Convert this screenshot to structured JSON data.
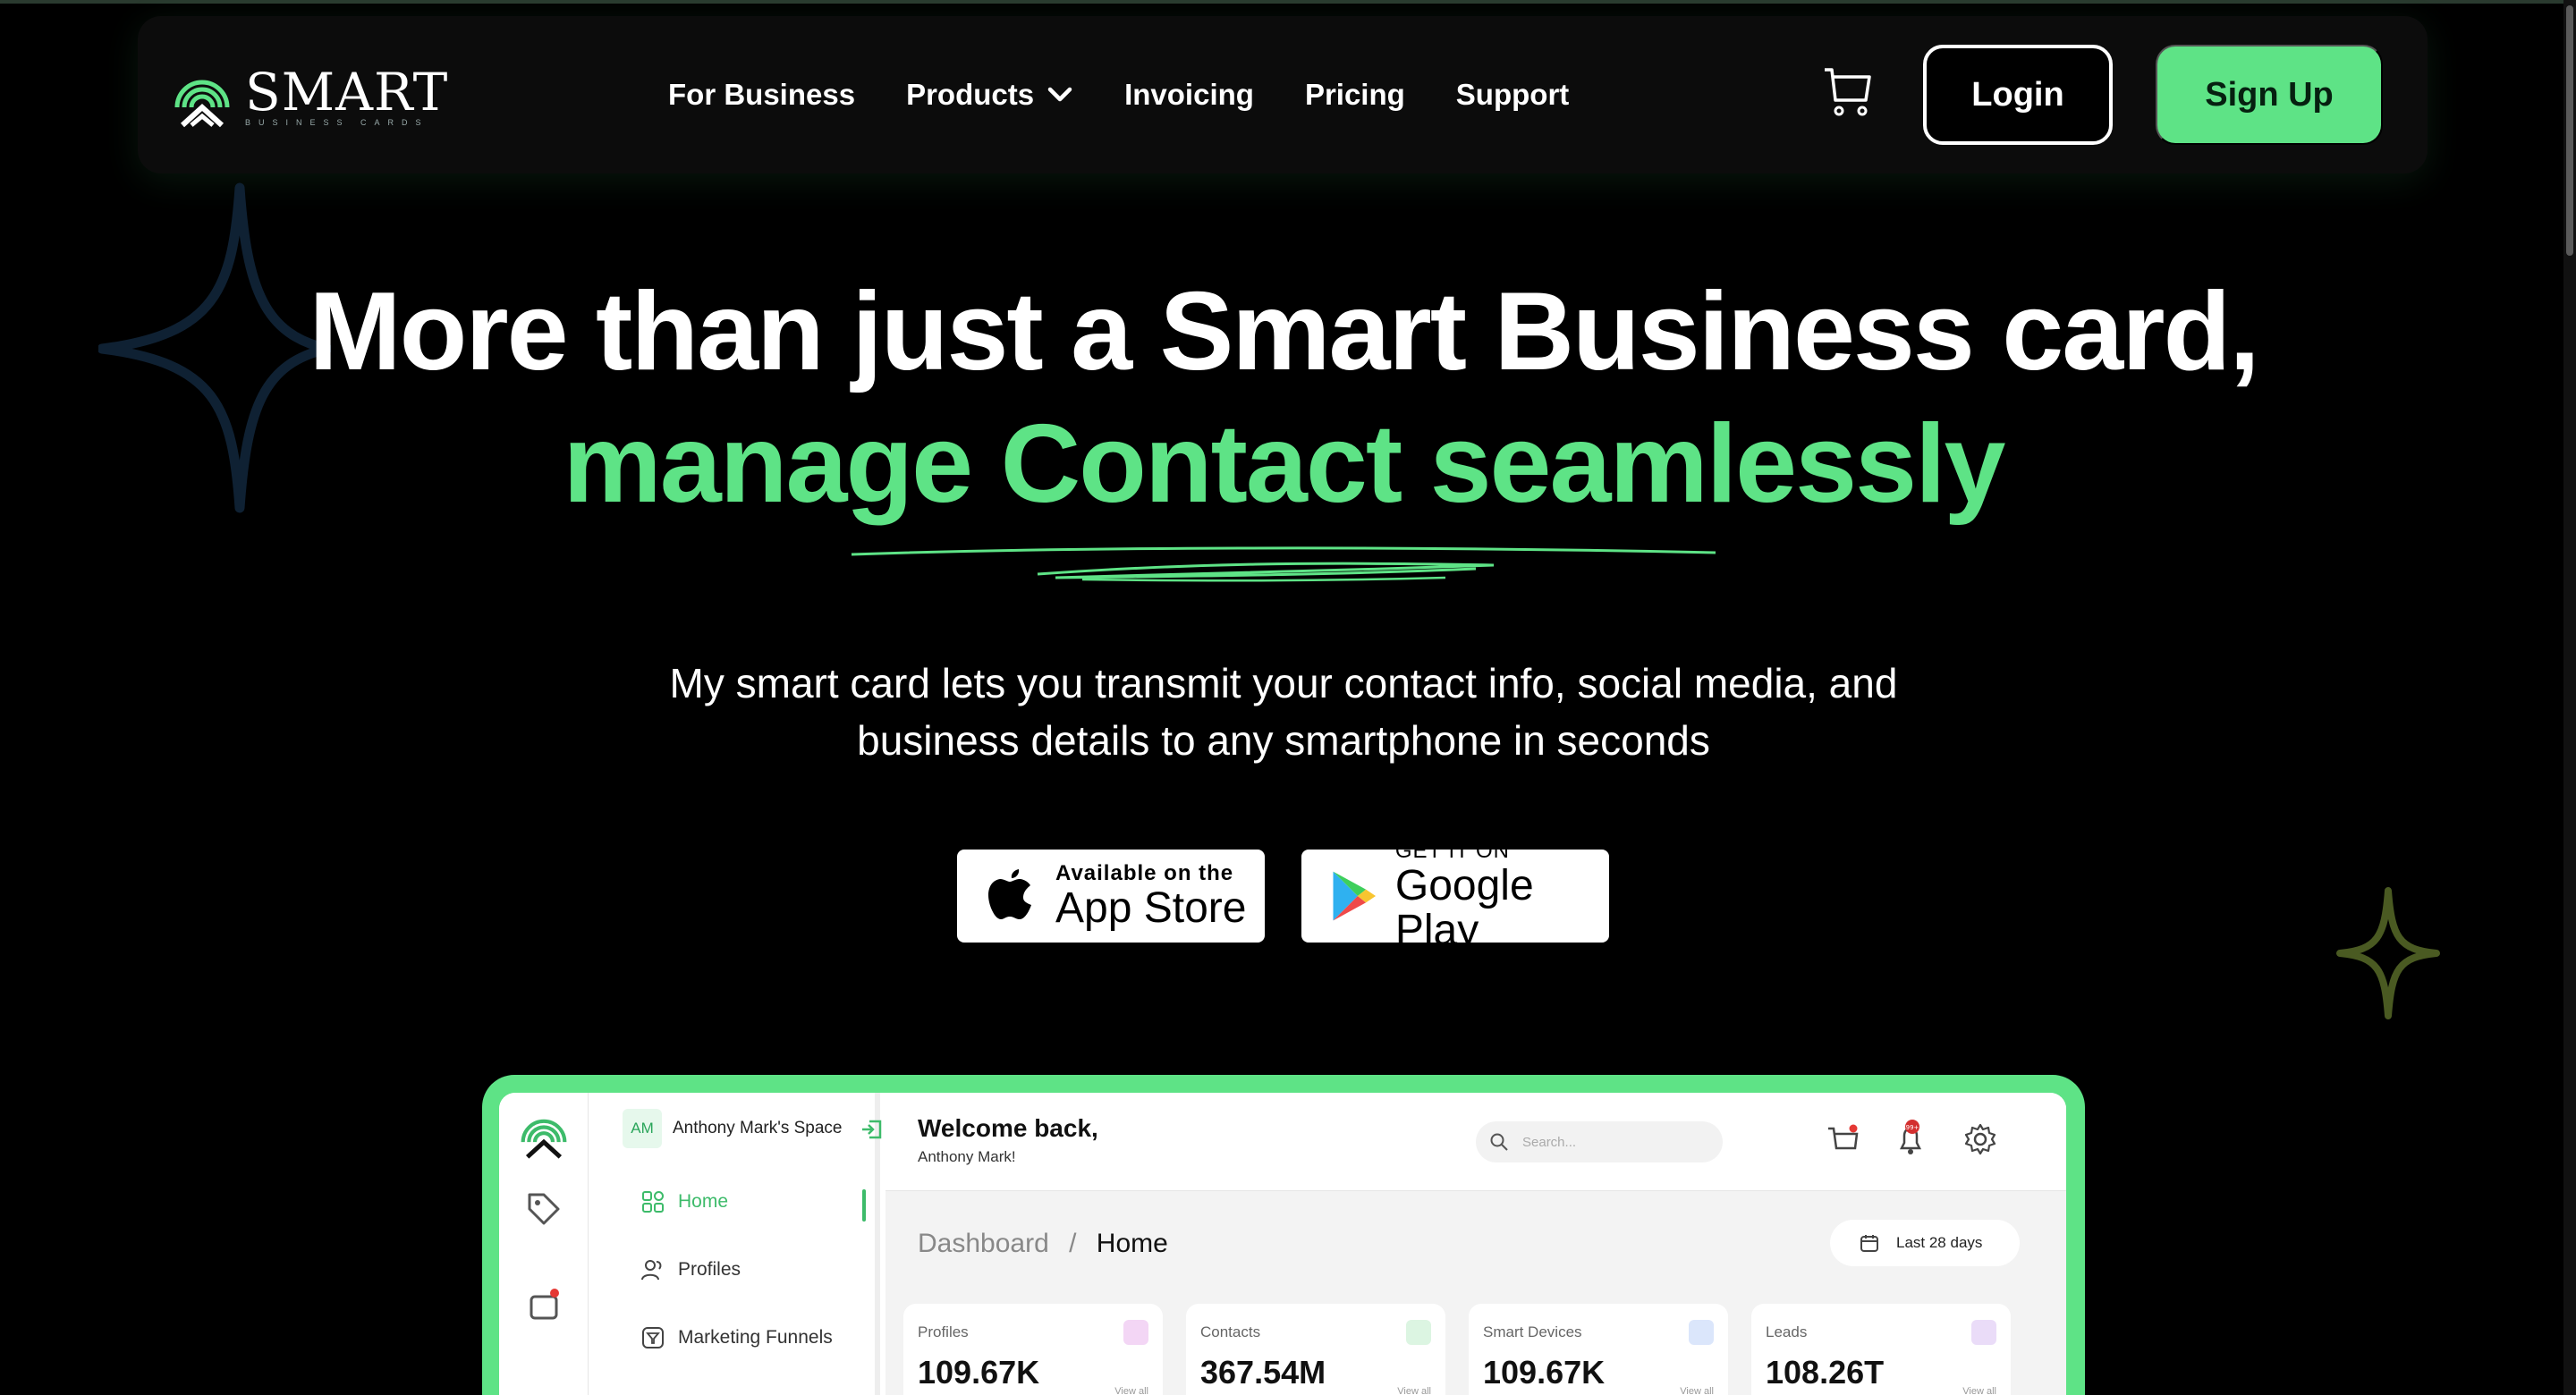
{
  "brand": {
    "name": "SMART",
    "tagline": "BUSINESS CARDS",
    "accent": "#5ee386"
  },
  "nav": {
    "links": [
      {
        "label": "For Business"
      },
      {
        "label": "Products"
      },
      {
        "label": "Invoicing"
      },
      {
        "label": "Pricing"
      },
      {
        "label": "Support"
      }
    ],
    "cart_icon": "cart-icon",
    "login_label": "Login",
    "signup_label": "Sign Up"
  },
  "hero": {
    "line1": "More than just a Smart Business card,",
    "line2": "manage Contact seamlessly",
    "subtitle_line1": "My smart card lets you transmit your contact info, social media, and",
    "subtitle_line2": "business details to any smartphone in seconds"
  },
  "stores": {
    "apple": {
      "small": "Available on the",
      "big": "App Store"
    },
    "google": {
      "small": "GET IT ON",
      "big": "Google Play"
    }
  },
  "dashboard": {
    "space_initials": "AM",
    "space_name": "Anthony Mark's Space",
    "sidebar": [
      {
        "label": "Home"
      },
      {
        "label": "Profiles"
      },
      {
        "label": "Marketing Funnels"
      }
    ],
    "welcome": "Welcome back,",
    "welcome_name": "Anthony Mark!",
    "search_placeholder": "Search...",
    "notification_count": "99+",
    "breadcrumb_root": "Dashboard",
    "breadcrumb_sep": "/",
    "breadcrumb_current": "Home",
    "date_range": "Last 28 days",
    "stats": [
      {
        "label": "Profiles",
        "value": "109.67K",
        "view": "View all",
        "color": "#f3d6f5"
      },
      {
        "label": "Contacts",
        "value": "367.54M",
        "view": "View all",
        "color": "#dcf5e2"
      },
      {
        "label": "Smart Devices",
        "value": "109.67K",
        "view": "View all",
        "color": "#dbe6fb"
      },
      {
        "label": "Leads",
        "value": "108.26T",
        "view": "View all",
        "color": "#eadcf8"
      }
    ]
  }
}
